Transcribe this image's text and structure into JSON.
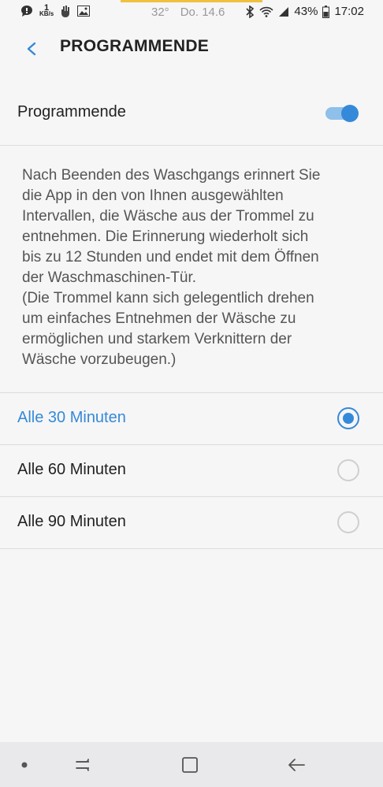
{
  "status_bar": {
    "kb_value": "1",
    "kb_unit": "KB/s",
    "temperature": "32°",
    "date": "Do. 14.6",
    "battery": "43%",
    "time": "17:02",
    "accent_color": "#f0c040"
  },
  "header": {
    "title": "PROGRAMMENDE",
    "back_icon": "chevron-left-icon"
  },
  "toggle_row": {
    "label": "Programmende",
    "enabled": true
  },
  "description": "Nach Beenden des Waschgangs erinnert Sie\ndie App in den von Ihnen ausgewählten\nIntervallen, die Wäsche aus der Trommel zu\nentnehmen. Die Erinnerung wiederholt sich\nbis zu 12 Stunden und endet mit dem Öffnen\nder Waschmaschinen-Tür.\n(Die Trommel kann sich gelegentlich drehen\num einfaches Entnehmen der Wäsche zu\nermöglichen und starkem Verknittern der\nWäsche vorzubeugen.)",
  "options": [
    {
      "label": "Alle 30 Minuten",
      "selected": true
    },
    {
      "label": "Alle 60 Minuten",
      "selected": false
    },
    {
      "label": "Alle 90 Minuten",
      "selected": false
    }
  ],
  "nav_bar": {
    "icons": [
      "dot-icon",
      "recents-icon",
      "home-icon",
      "back-icon"
    ]
  },
  "colors": {
    "accent": "#3589d9",
    "accent_light": "#8ec0ea",
    "background": "#f6f6f6",
    "divider": "#dcdcdc"
  }
}
